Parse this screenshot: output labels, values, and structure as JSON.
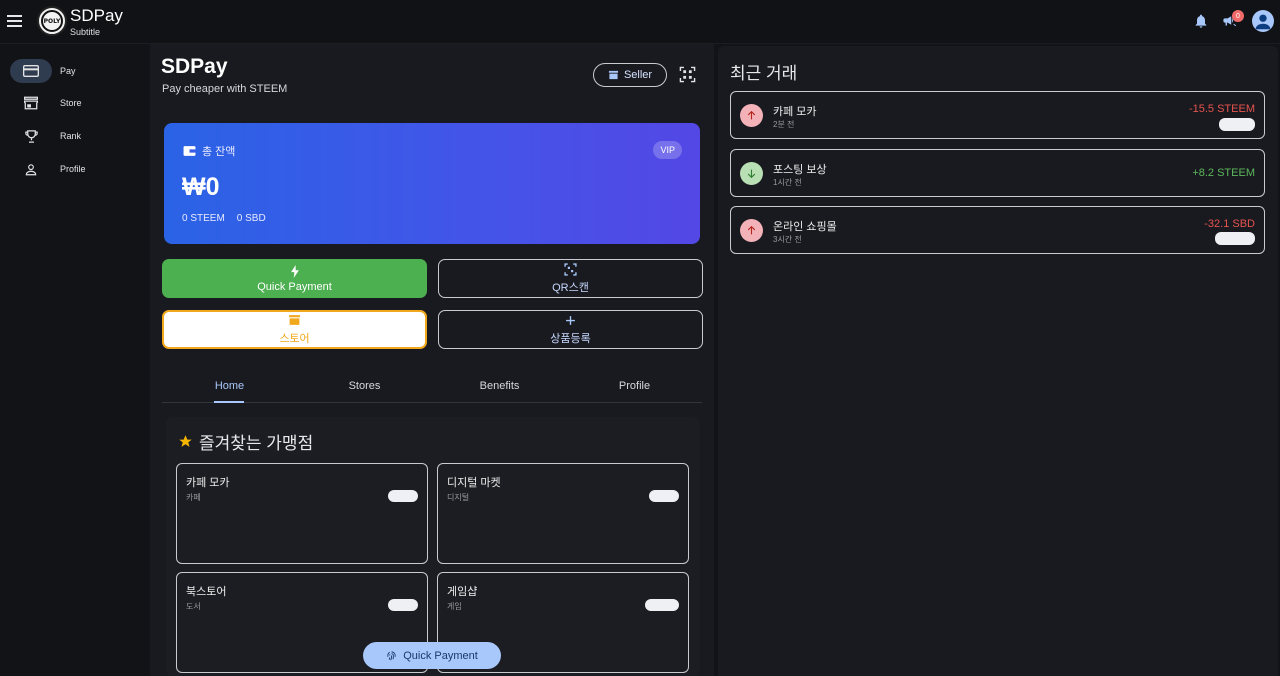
{
  "app": {
    "title": "SDPay",
    "subtitle": "Subtitle",
    "logo_text": "POLY",
    "notification_count": "0"
  },
  "sidebar": {
    "items": [
      {
        "label": "Pay",
        "icon": "credit-card-icon",
        "active": true
      },
      {
        "label": "Store",
        "icon": "store-icon",
        "active": false
      },
      {
        "label": "Rank",
        "icon": "trophy-icon",
        "active": false
      },
      {
        "label": "Profile",
        "icon": "person-icon",
        "active": false
      }
    ]
  },
  "main": {
    "title": "SDPay",
    "subtitle": "Pay cheaper with STEEM",
    "seller_label": "Seller",
    "balance": {
      "label": "총 잔액",
      "badge": "VIP",
      "amount": "₩0",
      "steem": "0 STEEM",
      "sbd": "0 SBD"
    },
    "actions": {
      "quick_payment": "Quick Payment",
      "qr_scan": "QR스캔",
      "store": "스토어",
      "product_register": "상품등록"
    },
    "tabs": [
      {
        "label": "Home",
        "active": true
      },
      {
        "label": "Stores",
        "active": false
      },
      {
        "label": "Benefits",
        "active": false
      },
      {
        "label": "Profile",
        "active": false
      }
    ],
    "favorites": {
      "title": "즐겨찾는 가맹점",
      "items": [
        {
          "name": "카페 모카",
          "category": "카페"
        },
        {
          "name": "디지털 마켓",
          "category": "디지털"
        },
        {
          "name": "북스토어",
          "category": "도서"
        },
        {
          "name": "게임샵",
          "category": "게임"
        }
      ]
    },
    "fab_label": "Quick Payment"
  },
  "recent": {
    "title": "최근 거래",
    "transactions": [
      {
        "name": "카페 모카",
        "time": "2분 전",
        "amount": "-15.5 STEEM",
        "direction": "out"
      },
      {
        "name": "포스팅 보상",
        "time": "1시간 전",
        "amount": "+8.2 STEEM",
        "direction": "in"
      },
      {
        "name": "온라인 쇼핑몰",
        "time": "3시간 전",
        "amount": "-32.1 SBD",
        "direction": "out"
      }
    ]
  },
  "colors": {
    "accent": "#a8c7fa",
    "quick_payment_green": "#4caf50",
    "store_orange": "#f2a81d",
    "negative": "#e6534f",
    "positive": "#5cb85c"
  }
}
